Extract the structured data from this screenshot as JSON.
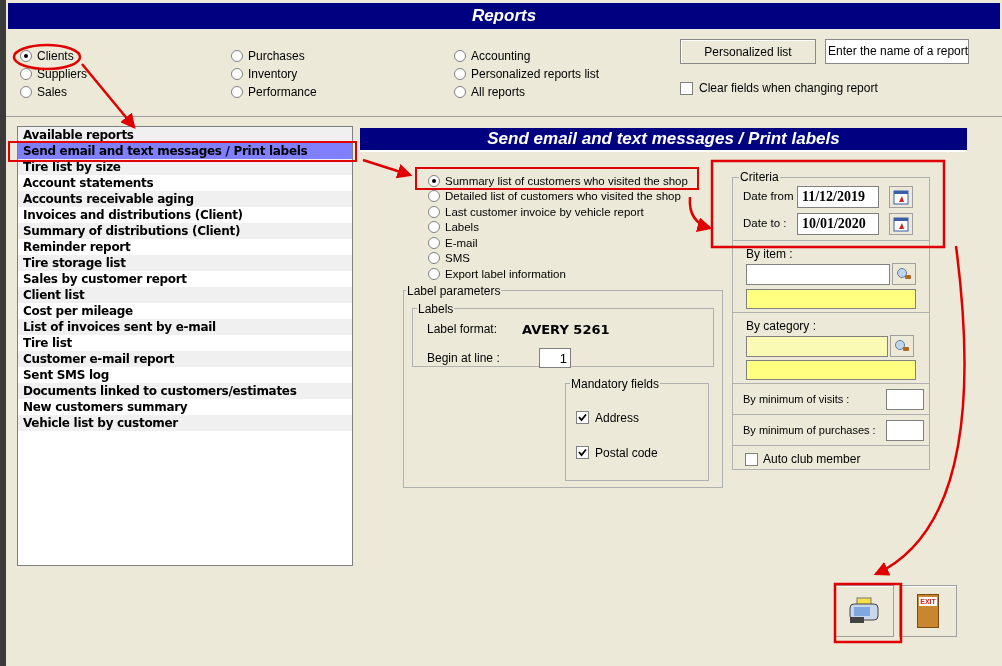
{
  "window": {
    "title": "Reports"
  },
  "report_types": [
    {
      "label": "Clients",
      "selected": true
    },
    {
      "label": "Suppliers",
      "selected": false
    },
    {
      "label": "Sales",
      "selected": false
    },
    {
      "label": "Purchases",
      "selected": false
    },
    {
      "label": "Inventory",
      "selected": false
    },
    {
      "label": "Performance",
      "selected": false
    },
    {
      "label": "Accounting",
      "selected": false
    },
    {
      "label": "Personalized reports list",
      "selected": false
    },
    {
      "label": "All reports",
      "selected": false
    }
  ],
  "personalized_list_button": "Personalized list",
  "report_name_field": {
    "value": "Enter the name of a report"
  },
  "clear_fields": {
    "label": "Clear fields when changing report",
    "checked": false
  },
  "available_reports": {
    "header": "Available reports",
    "items": [
      {
        "label": "Send email and text messages / Print labels",
        "selected": true
      },
      {
        "label": "Tire list by size",
        "selected": false
      },
      {
        "label": "Account statements",
        "selected": false
      },
      {
        "label": "Accounts receivable aging",
        "selected": false
      },
      {
        "label": "Invoices and distributions (Client)",
        "selected": false
      },
      {
        "label": "Summary of distributions (Client)",
        "selected": false
      },
      {
        "label": "Reminder report",
        "selected": false
      },
      {
        "label": "Tire storage list",
        "selected": false
      },
      {
        "label": "Sales by customer report",
        "selected": false
      },
      {
        "label": "Client list",
        "selected": false
      },
      {
        "label": "Cost per mileage",
        "selected": false
      },
      {
        "label": "List of invoices sent by e-mail",
        "selected": false
      },
      {
        "label": "Tire list",
        "selected": false
      },
      {
        "label": "Customer e-mail report",
        "selected": false
      },
      {
        "label": "Sent SMS log",
        "selected": false
      },
      {
        "label": "Documents linked to customers/estimates",
        "selected": false
      },
      {
        "label": "New customers summary",
        "selected": false
      },
      {
        "label": "Vehicle list by customer",
        "selected": false
      }
    ]
  },
  "panel": {
    "title": "Send email and text messages / Print labels",
    "options": [
      {
        "label": "Summary list of customers who visited the shop",
        "selected": true
      },
      {
        "label": "Detailed list of customers who visited the shop",
        "selected": false
      },
      {
        "label": "Last customer invoice by vehicle report",
        "selected": false
      },
      {
        "label": "Labels",
        "selected": false
      },
      {
        "label": "E-mail",
        "selected": false
      },
      {
        "label": "SMS",
        "selected": false
      },
      {
        "label": "Export label information",
        "selected": false
      }
    ],
    "label_parameters": {
      "legend": "Label parameters",
      "labels_legend": "Labels",
      "format_label": "Label format:",
      "format_value": "AVERY 5261",
      "begin_label": "Begin at line :",
      "begin_value": "1",
      "mandatory_legend": "Mandatory fields",
      "mandatory": [
        {
          "label": "Address",
          "checked": true
        },
        {
          "label": "Postal code",
          "checked": true
        }
      ]
    },
    "criteria": {
      "legend": "Criteria",
      "date_from_label": "Date from",
      "date_from": "11/12/2019",
      "date_to_label": "Date to :",
      "date_to": "10/01/2020",
      "by_item": "By item :",
      "by_category": "By category :",
      "min_visits": "By minimum of visits :",
      "min_purchases": "By minimum of purchases :",
      "auto_club": {
        "label": "Auto club member",
        "checked": false
      }
    }
  },
  "exit_button": {
    "sign": "EXIT"
  }
}
